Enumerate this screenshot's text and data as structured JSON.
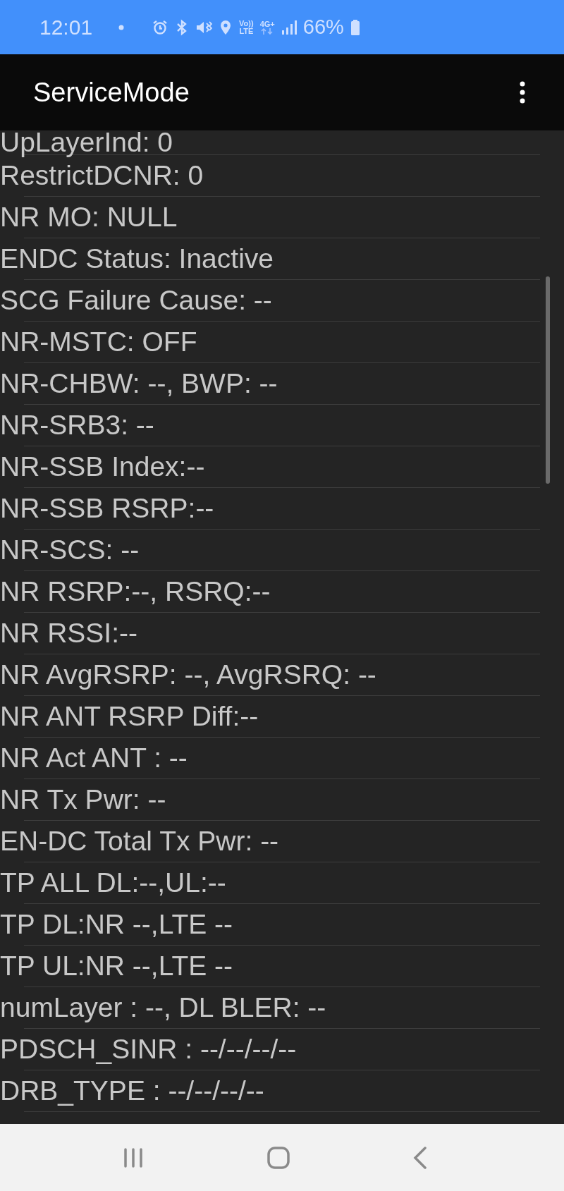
{
  "status_bar": {
    "time": "12:01",
    "volte_top": "Vo))",
    "volte_bottom": "LTE",
    "network": "4G+",
    "battery": "66%"
  },
  "app_bar": {
    "title": "ServiceMode"
  },
  "rows": [
    "UpLayerInd: 0",
    "RestrictDCNR: 0",
    "NR MO: NULL",
    "ENDC Status: Inactive",
    "SCG Failure Cause: --",
    "NR-MSTC: OFF",
    "NR-CHBW: --, BWP: --",
    "NR-SRB3: --",
    "NR-SSB Index:--",
    "NR-SSB RSRP:--",
    "NR-SCS: --",
    "NR RSRP:--, RSRQ:--",
    "NR RSSI:--",
    "NR AvgRSRP: --, AvgRSRQ: --",
    "NR ANT RSRP Diff:--",
    "NR Act ANT : --",
    "NR Tx Pwr: --",
    "EN-DC Total Tx Pwr: --",
    "TP ALL DL:--,UL:--",
    "TP DL:NR --,LTE --",
    "TP UL:NR --,LTE --",
    "numLayer : --, DL BLER: --",
    "PDSCH_SINR : --/--/--/--",
    "DRB_TYPE : --/--/--/--"
  ]
}
